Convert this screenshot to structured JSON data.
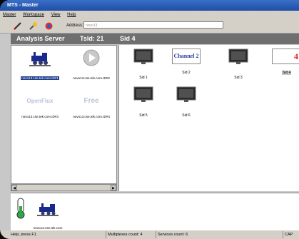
{
  "window": {
    "title": "MTS - Master"
  },
  "menu": {
    "items": [
      "Master",
      "Workspace",
      "View",
      "Help"
    ]
  },
  "toolbar": {
    "icons": [
      "pencil-icon",
      "magic-wand-icon",
      "swirl-icon"
    ],
    "address_label": "Address:",
    "address_value": "novo13"
  },
  "header": {
    "server": "Analysis Server",
    "tsid": "TsId: 21",
    "sid": "Sid 4"
  },
  "hosts": [
    {
      "label": "novo13.cse.tek.com.ID#1",
      "icon": "locomotive-icon",
      "selected": true
    },
    {
      "label": "novo13.cse.tek.com.ID#2",
      "icon": "play-icon",
      "selected": false
    },
    {
      "label": "novo13.cse.tek.com.ID#3",
      "icon": "openflux-logo",
      "logo_text": "OpenFlux",
      "selected": false
    },
    {
      "label": "novo13.cse.tek.com.ID#4",
      "icon": "free-logo",
      "logo_text": "Free",
      "selected": false
    }
  ],
  "services": [
    {
      "label": "Sid 1",
      "icon": "tv-icon",
      "selected": false
    },
    {
      "label": "Sid 2",
      "icon": "channel-thumbnail",
      "thumb_text": "Channel 2",
      "selected": false
    },
    {
      "label": "Sid 3",
      "icon": "tv-icon",
      "selected": false
    },
    {
      "label": "Sid 4",
      "icon": "channel-thumbnail",
      "thumb_text": "4",
      "selected": true
    },
    {
      "label": "Sid 5",
      "icon": "tv-icon",
      "selected": false
    },
    {
      "label": "Sid 6",
      "icon": "tv-icon",
      "selected": false
    }
  ],
  "bottom": {
    "host_label": "novo13.cse.tek.com"
  },
  "status": {
    "help": "Help, press F1",
    "multiplexes": "Multiplexes count: 4",
    "services": "Services count: 6",
    "caps": "CAP"
  }
}
